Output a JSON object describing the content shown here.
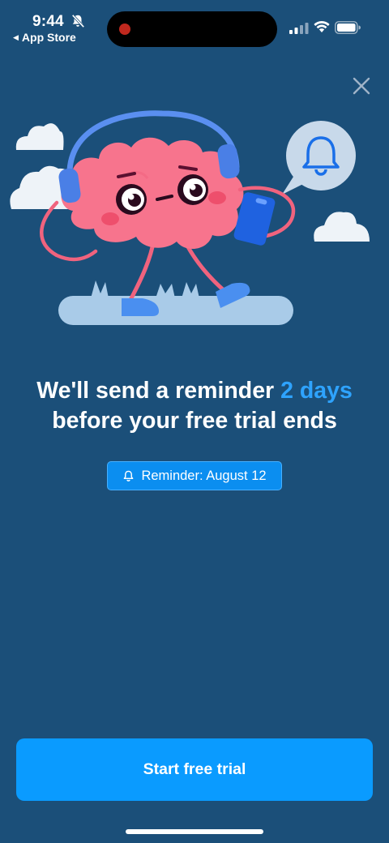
{
  "status_bar": {
    "time": "9:44",
    "back_app": "App Store",
    "icons": [
      "bell-muted-icon",
      "signal-icon",
      "wifi-icon",
      "battery-icon"
    ]
  },
  "close_icon": "close-icon",
  "illustration": {
    "subject": "brain-character-icon",
    "elements": [
      "cloud-icon",
      "headphones-icon",
      "phone-icon",
      "bell-bubble-icon"
    ]
  },
  "headline": {
    "part1": "We'll send a reminder ",
    "accent": "2 days",
    "part2": "before your free trial ends"
  },
  "reminder_badge": {
    "icon": "bell-icon",
    "label": "Reminder: August 12"
  },
  "cta": {
    "label": "Start free trial"
  },
  "colors": {
    "background": "#1b4f79",
    "accent": "#2ea3ff",
    "button": "#0a9bff"
  }
}
